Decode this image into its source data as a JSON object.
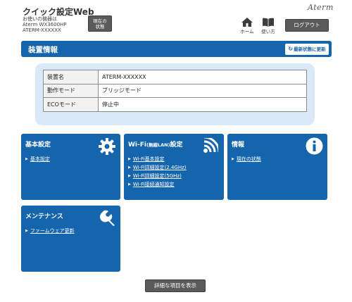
{
  "header": {
    "title": "クイック設定Web",
    "device_label": "お使いの機器は",
    "device_model": "Aterm WX3600HP",
    "device_name": "ATERM-XXXXXX",
    "status_button": "現在の状態",
    "brand": "Aterm",
    "nav": {
      "home": "ホーム",
      "manual": "使い方"
    },
    "logout": "ログアウト"
  },
  "device_info": {
    "title": "装置情報",
    "refresh": "最新状態に更新",
    "rows": [
      {
        "key": "装置名",
        "value": "ATERM-XXXXXX"
      },
      {
        "key": "動作モード",
        "value": "ブリッジモード"
      },
      {
        "key": "ECOモード",
        "value": "停止中"
      }
    ]
  },
  "panels": {
    "basic": {
      "title": "基本設定",
      "icon": "gear-icon",
      "links": [
        "基本設定"
      ]
    },
    "wifi": {
      "title": "Wi-Fi",
      "title_small": "(無線LAN)",
      "title_suffix": "設定",
      "icon": "wifi-icon",
      "links": [
        "Wi-Fi基本設定",
        "Wi-Fi詳細設定(2.4GHz)",
        "Wi-Fi詳細設定(5GHz)",
        "Wi-Fi接続通知設定"
      ]
    },
    "info": {
      "title": "情報",
      "icon": "info-icon",
      "links": [
        "現在の状態"
      ]
    },
    "maintenance": {
      "title": "メンテナンス",
      "icon": "wrench-icon",
      "links": [
        "ファームウェア更新"
      ]
    }
  },
  "advanced_button": "詳細な項目を表示",
  "colors": {
    "accent": "#1565ad",
    "button_gray": "#5a5a5a",
    "table_bg": "#d9e9f7"
  }
}
